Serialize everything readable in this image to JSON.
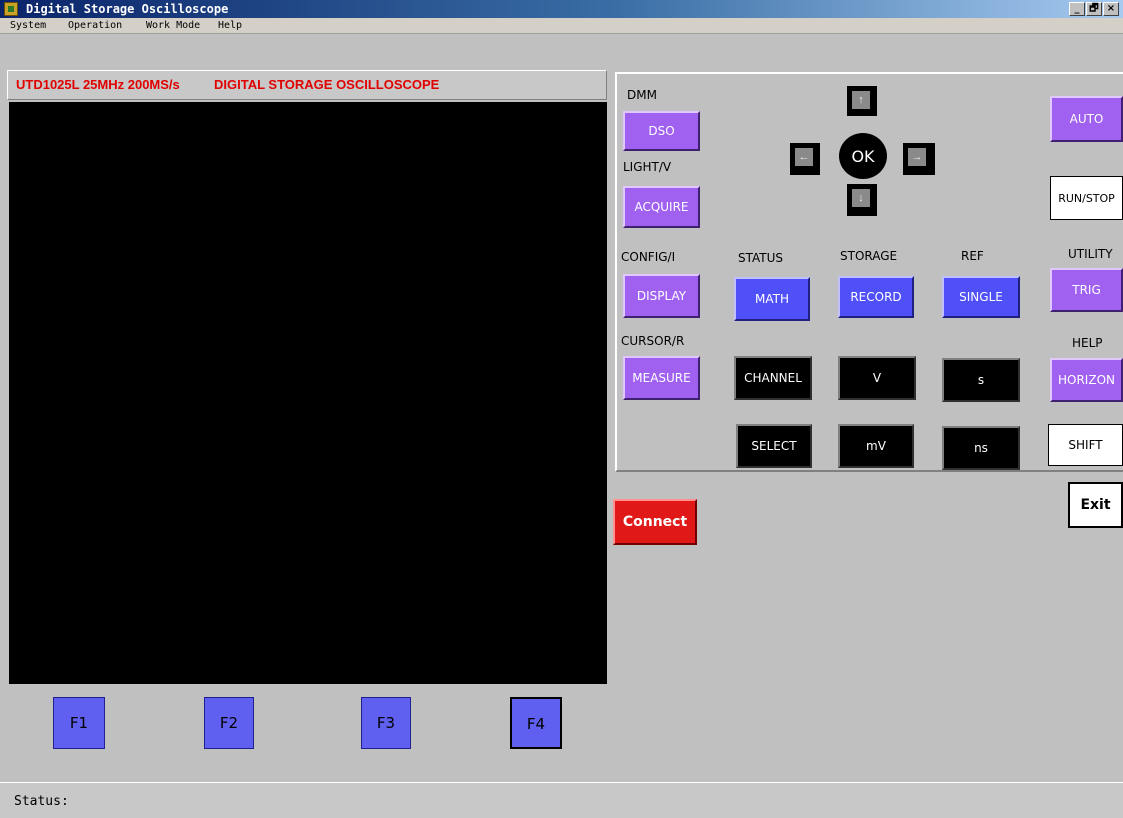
{
  "window": {
    "title": "Digital Storage Oscilloscope",
    "min": "_",
    "max": "🗗",
    "close": "×"
  },
  "menu": [
    "System",
    "Operation",
    "Work Mode",
    "Help"
  ],
  "header": {
    "model": "UTD1025L 25MHz 200MS/s",
    "name": "DIGITAL STORAGE OSCILLOSCOPE"
  },
  "fbuttons": [
    "F1",
    "F2",
    "F3",
    "F4"
  ],
  "status": {
    "label": "Status:"
  },
  "panel": {
    "labels": {
      "dmm": "DMM",
      "light_v": "LIGHT/V",
      "config_i": "CONFIG/I",
      "cursor_r": "CURSOR/R",
      "status": "STATUS",
      "storage": "STORAGE",
      "ref": "REF",
      "utility": "UTILITY",
      "help": "HELP"
    },
    "buttons": {
      "dso": "DSO",
      "acquire": "ACQUIRE",
      "display": "DISPLAY",
      "measure": "MEASURE",
      "math": "MATH",
      "record": "RECORD",
      "single": "SINGLE",
      "auto": "AUTO",
      "run_stop": "RUN/STOP",
      "trig": "TRIG",
      "horizon": "HORIZON",
      "shift": "SHIFT",
      "channel": "CHANNEL",
      "v": "V",
      "s": "s",
      "select": "SELECT",
      "mv": "mV",
      "ns": "ns",
      "ok": "OK"
    },
    "arrows": {
      "up": "↑",
      "down": "↓",
      "left": "←",
      "right": "→"
    }
  },
  "connect": "Connect",
  "exit": "Exit",
  "colors": {
    "purple": "#a060f0",
    "blue": "#5050f8",
    "connect": "#e01818",
    "header_text": "#e00000"
  }
}
